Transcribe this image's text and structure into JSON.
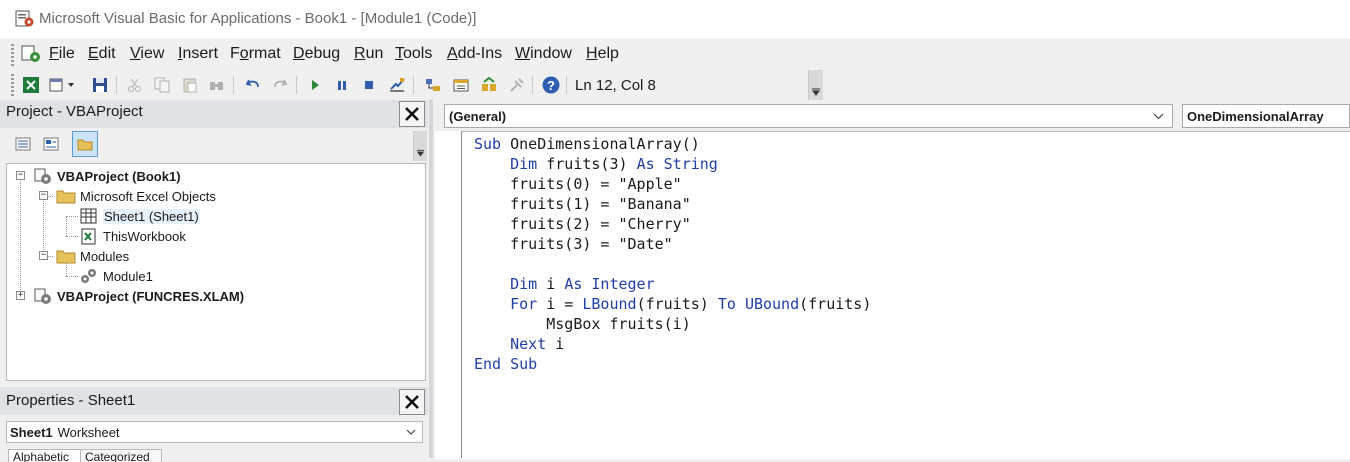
{
  "window": {
    "title": "Microsoft Visual Basic for Applications - Book1 - [Module1 (Code)]",
    "app_icon": "vba-app-icon"
  },
  "menu": {
    "items": [
      "File",
      "Edit",
      "View",
      "Insert",
      "Format",
      "Debug",
      "Run",
      "Tools",
      "Add-Ins",
      "Window",
      "Help"
    ]
  },
  "toolbar": {
    "buttons": [
      "view-excel-icon",
      "insert-userform-icon",
      "save-icon",
      "cut-icon",
      "copy-icon",
      "paste-icon",
      "find-icon",
      "undo-icon",
      "redo-icon",
      "run-icon",
      "break-icon",
      "reset-icon",
      "design-mode-icon",
      "project-explorer-icon",
      "properties-icon",
      "object-browser-icon",
      "toolbox-icon",
      "help-icon"
    ],
    "position": "Ln 12, Col 8"
  },
  "project_pane": {
    "title": "Project - VBAProject",
    "tree": [
      {
        "label": "VBAProject (Book1)",
        "bold": true,
        "level": 0,
        "expander": "−",
        "icon": "vbaproject-icon"
      },
      {
        "label": "Microsoft Excel Objects",
        "bold": false,
        "level": 1,
        "expander": "−",
        "icon": "folder-icon"
      },
      {
        "label": "Sheet1 (Sheet1)",
        "bold": false,
        "level": 2,
        "expander": "",
        "icon": "worksheet-icon",
        "selected": true
      },
      {
        "label": "ThisWorkbook",
        "bold": false,
        "level": 2,
        "expander": "",
        "icon": "workbook-icon"
      },
      {
        "label": "Modules",
        "bold": false,
        "level": 1,
        "expander": "−",
        "icon": "folder-icon"
      },
      {
        "label": "Module1",
        "bold": false,
        "level": 2,
        "expander": "",
        "icon": "module-icon"
      },
      {
        "label": "VBAProject (FUNCRES.XLAM)",
        "bold": true,
        "level": 0,
        "expander": "+",
        "icon": "vbaproject-icon"
      }
    ]
  },
  "properties_pane": {
    "title": "Properties - Sheet1",
    "object_name": "Sheet1",
    "object_type": "Worksheet",
    "tabs": [
      "Alphabetic",
      "Categorized"
    ]
  },
  "code_window": {
    "object_combo": "(General)",
    "procedure_combo": "OneDimensionalArray",
    "lines": [
      [
        {
          "t": "Sub ",
          "k": true
        },
        {
          "t": "OneDimensionalArray()",
          "k": false
        }
      ],
      [
        {
          "t": "    ",
          "k": false
        },
        {
          "t": "Dim ",
          "k": true
        },
        {
          "t": "fruits(3) ",
          "k": false
        },
        {
          "t": "As String",
          "k": true
        }
      ],
      [
        {
          "t": "    fruits(0) = \"Apple\"",
          "k": false
        }
      ],
      [
        {
          "t": "    fruits(1) = \"Banana\"",
          "k": false
        }
      ],
      [
        {
          "t": "    fruits(2) = \"Cherry\"",
          "k": false
        }
      ],
      [
        {
          "t": "    fruits(3) = \"Date\"",
          "k": false
        }
      ],
      [
        {
          "t": "",
          "k": false
        }
      ],
      [
        {
          "t": "    ",
          "k": false
        },
        {
          "t": "Dim ",
          "k": true
        },
        {
          "t": "i ",
          "k": false
        },
        {
          "t": "As Integer",
          "k": true
        }
      ],
      [
        {
          "t": "    ",
          "k": false
        },
        {
          "t": "For ",
          "k": true
        },
        {
          "t": "i = ",
          "k": false
        },
        {
          "t": "LBound",
          "k": true
        },
        {
          "t": "(fruits) ",
          "k": false
        },
        {
          "t": "To ",
          "k": true
        },
        {
          "t": "UBound",
          "k": true
        },
        {
          "t": "(fruits)",
          "k": false
        }
      ],
      [
        {
          "t": "        MsgBox fruits(i)",
          "k": false
        }
      ],
      [
        {
          "t": "    ",
          "k": false
        },
        {
          "t": "Next ",
          "k": true
        },
        {
          "t": "i",
          "k": false
        }
      ],
      [
        {
          "t": "End Sub",
          "k": true
        }
      ]
    ]
  },
  "colors": {
    "keyword": "#1f3fa8",
    "code_text": "#1b1b1b",
    "pane_header": "#dfe3e8",
    "selection": "#e5f1fb"
  }
}
